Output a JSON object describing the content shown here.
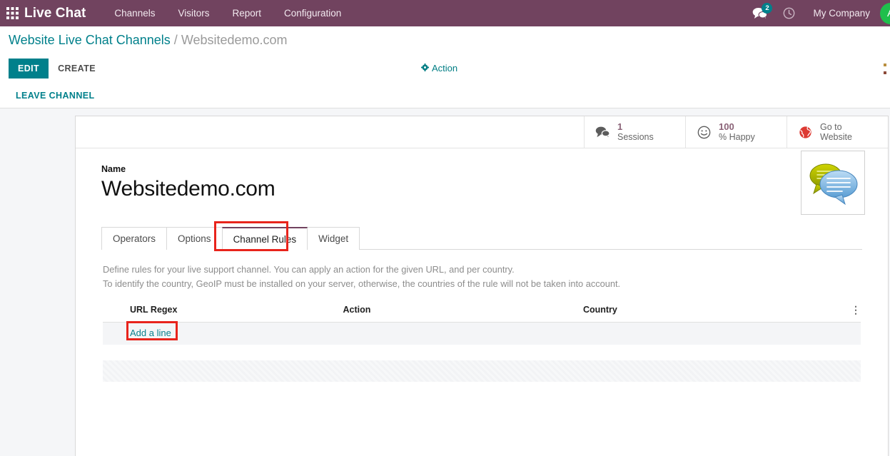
{
  "navbar": {
    "apps_icon": "apps-grid-icon",
    "brand": "Live Chat",
    "menu": [
      {
        "label": "Channels"
      },
      {
        "label": "Visitors"
      },
      {
        "label": "Report"
      },
      {
        "label": "Configuration"
      }
    ],
    "messages_icon": "chat-bubble-icon",
    "messages_count": "2",
    "activities_icon": "clock-icon",
    "company": "My Company",
    "avatar_letter": "A",
    "bar_color": "#71435f",
    "badge_color": "#00808b",
    "avatar_color": "#1fbf4c"
  },
  "breadcrumb": {
    "parent": "Website Live Chat Channels",
    "separator": "/",
    "current": "Websitedemo.com"
  },
  "control_panel": {
    "edit_label": "EDIT",
    "create_label": "CREATE",
    "action_label": "Action",
    "action_icon": "gear-icon",
    "leave_label": "LEAVE CHANNEL",
    "edit_color": "#00808b",
    "link_color": "#00808b"
  },
  "stat_buttons": [
    {
      "icon": "chat-bubbles-icon",
      "value": "1",
      "label": "Sessions"
    },
    {
      "icon": "smiley-face-icon",
      "value": "100",
      "label": "% Happy"
    },
    {
      "icon": "globe-icon",
      "label_line1": "Go to",
      "label_line2": "Website"
    }
  ],
  "form": {
    "name_label": "Name",
    "name_value": "Websitedemo.com",
    "image_icon": "chat-bubbles-image"
  },
  "tabs": [
    {
      "label": "Operators",
      "active": false
    },
    {
      "label": "Options",
      "active": false
    },
    {
      "label": "Channel Rules",
      "active": true
    },
    {
      "label": "Widget",
      "active": false
    }
  ],
  "channel_rules": {
    "description_line1": "Define rules for your live support channel. You can apply an action for the given URL, and per country.",
    "description_line2": "To identify the country, GeoIP must be installed on your server, otherwise, the countries of the rule will not be taken into account.",
    "columns": [
      "URL Regex",
      "Action",
      "Country"
    ],
    "optional_columns_icon": "vertical-dots-icon",
    "rows": [],
    "add_line_label": "Add a line"
  },
  "annotations": {
    "highlight_color": "#e8241c",
    "highlighted_elements": [
      "Channel Rules",
      "Add a line"
    ]
  }
}
